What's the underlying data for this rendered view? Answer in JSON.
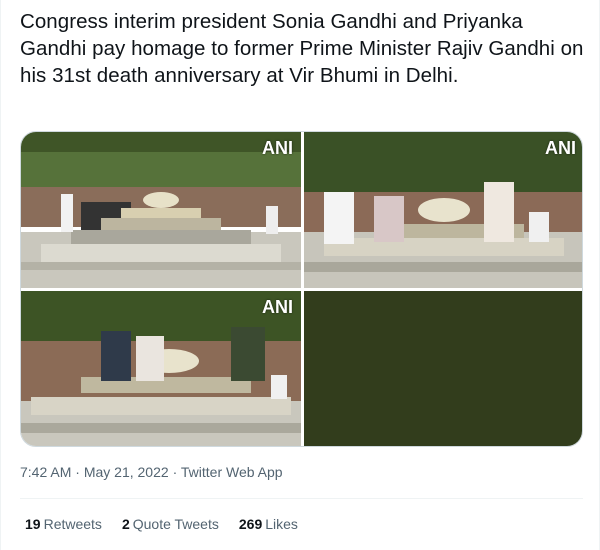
{
  "tweet": {
    "text": "Congress interim president Sonia Gandhi and Priyanka Gandhi pay homage to former Prime Minister Rajiv Gandhi on his 31st death anniversary at Vir Bhumi in Delhi.",
    "watermark": "ANI",
    "time": "7:42 AM",
    "separator": "·",
    "date": "May 21, 2022",
    "source": "Twitter Web App",
    "stats": {
      "retweets_count": "19",
      "retweets_label": "Retweets",
      "quotes_count": "2",
      "quotes_label": "Quote Tweets",
      "likes_count": "269",
      "likes_label": "Likes"
    }
  },
  "colors": {
    "text_primary": "#0f1419",
    "text_secondary": "#536471",
    "border": "#eff3f4",
    "empty_photo": "#323d1c"
  }
}
